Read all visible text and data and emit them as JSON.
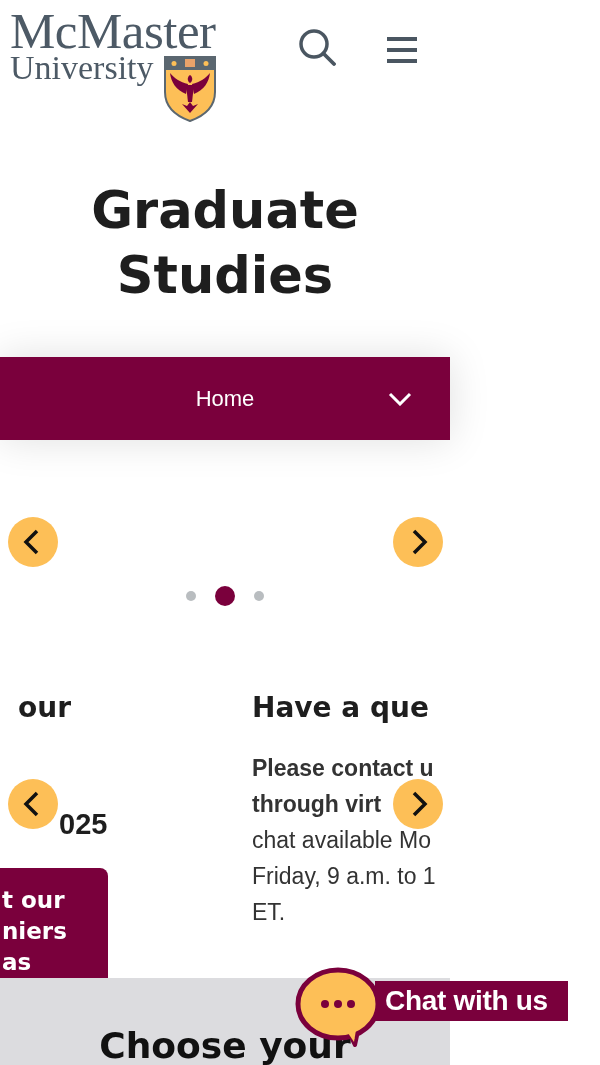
{
  "header": {
    "logo": {
      "wordmark": "McMaster",
      "subtitle": "University"
    }
  },
  "page_title": "Graduate Studies",
  "section_menu": {
    "label": "Home",
    "expanded": false
  },
  "slider": {
    "dots": [
      {
        "selected": false
      },
      {
        "selected": true
      },
      {
        "selected": false
      }
    ]
  },
  "cards": {
    "left": {
      "heading_lines": [
        "our",
        "025"
      ],
      "button": "t our\nniers\nas"
    },
    "right": {
      "heading": "Have a que",
      "body_lines": [
        {
          "text": "Please contact u",
          "bold": true
        },
        {
          "text": "through virt",
          "bold": true
        },
        {
          "text": "chat available Mo",
          "bold": false
        },
        {
          "text": "Friday, 9 a.m. to 1",
          "bold": false
        },
        {
          "text": "ET.",
          "bold": false
        }
      ]
    }
  },
  "lower_section": {
    "heading": "Choose your"
  },
  "chat": {
    "label": "Chat with us"
  }
}
